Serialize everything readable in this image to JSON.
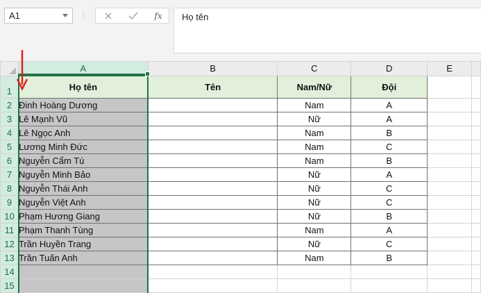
{
  "name_box": {
    "value": "A1"
  },
  "formula_bar": {
    "cancel_icon": "close-icon",
    "enter_icon": "check-icon",
    "fx_label": "fx",
    "content": "Họ tên"
  },
  "columns": [
    "A",
    "B",
    "C",
    "D",
    "E"
  ],
  "rows": [
    {
      "num": "1",
      "a": "Họ tên",
      "b": "Tên",
      "c": "Nam/Nữ",
      "d": "Đội"
    },
    {
      "num": "2",
      "a": "Đinh Hoàng Dương",
      "b": "",
      "c": "Nam",
      "d": "A"
    },
    {
      "num": "3",
      "a": "Lê Mạnh Vũ",
      "b": "",
      "c": "Nữ",
      "d": "A"
    },
    {
      "num": "4",
      "a": "Lê Ngọc Anh",
      "b": "",
      "c": "Nam",
      "d": "B"
    },
    {
      "num": "5",
      "a": "Lương Minh Đức",
      "b": "",
      "c": "Nam",
      "d": "C"
    },
    {
      "num": "6",
      "a": "Nguyễn Cẩm Tú",
      "b": "",
      "c": "Nam",
      "d": "B"
    },
    {
      "num": "7",
      "a": "Nguyễn Minh Bảo",
      "b": "",
      "c": "Nữ",
      "d": "A"
    },
    {
      "num": "8",
      "a": "Nguyễn Thái Anh",
      "b": "",
      "c": "Nữ",
      "d": "C"
    },
    {
      "num": "9",
      "a": "Nguyễn Việt Anh",
      "b": "",
      "c": "Nữ",
      "d": "C"
    },
    {
      "num": "10",
      "a": "Phạm Hương Giang",
      "b": "",
      "c": "Nữ",
      "d": "B"
    },
    {
      "num": "11",
      "a": "Phạm Thanh Tùng",
      "b": "",
      "c": "Nam",
      "d": "A"
    },
    {
      "num": "12",
      "a": "Trần Huyền Trang",
      "b": "",
      "c": "Nữ",
      "d": "C"
    },
    {
      "num": "13",
      "a": "Trần Tuấn Anh",
      "b": "",
      "c": "Nam",
      "d": "B"
    },
    {
      "num": "14",
      "a": "",
      "b": "",
      "c": "",
      "d": ""
    },
    {
      "num": "15",
      "a": "",
      "b": "",
      "c": "",
      "d": ""
    }
  ],
  "colors": {
    "header_fill": "#e2efda",
    "selected_column_fill": "#c6c6c6",
    "selection_border": "#217346",
    "annotation_arrow": "#e02020"
  }
}
